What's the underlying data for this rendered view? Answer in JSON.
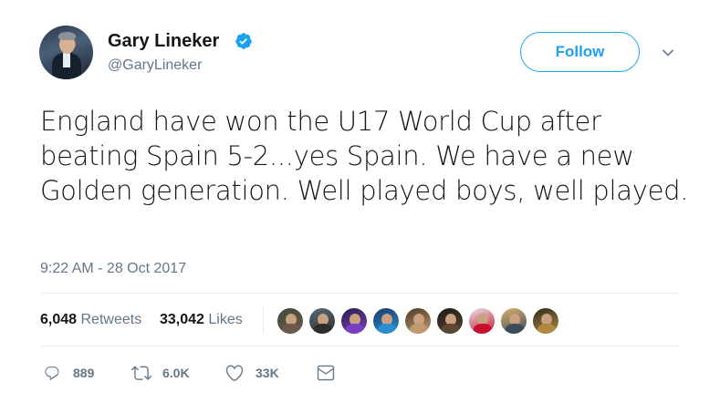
{
  "user": {
    "name": "Gary Lineker",
    "handle": "@GaryLineker",
    "verified": true
  },
  "follow_button": {
    "label": "Follow"
  },
  "tweet": {
    "text": "England have won the U17 World Cup after beating Spain 5-2...yes Spain. We have a new Golden generation. Well played boys, well played.",
    "timestamp": "9:22 AM - 28 Oct 2017"
  },
  "stats": {
    "retweets_count": "6,048",
    "retweets_label": "Retweets",
    "likes_count": "33,042",
    "likes_label": "Likes"
  },
  "likers": [
    {
      "icon": "liker-avatar-1",
      "colors": [
        "#6b5a4a",
        "#3f4a3a"
      ]
    },
    {
      "icon": "liker-avatar-2",
      "colors": [
        "#2c2c2c",
        "#5d6b7a"
      ]
    },
    {
      "icon": "liker-avatar-3",
      "colors": [
        "#7a3fbf",
        "#2a1f4a"
      ]
    },
    {
      "icon": "liker-avatar-4",
      "colors": [
        "#2a8fd0",
        "#1b3b6a"
      ]
    },
    {
      "icon": "liker-avatar-5",
      "colors": [
        "#c09a6e",
        "#4a3a2a"
      ]
    },
    {
      "icon": "liker-avatar-6",
      "colors": [
        "#5b4630",
        "#1e1a16"
      ]
    },
    {
      "icon": "liker-avatar-7",
      "colors": [
        "#c8102e",
        "#e5e5e5"
      ]
    },
    {
      "icon": "liker-avatar-8",
      "colors": [
        "#3c4a5c",
        "#d8b36a"
      ]
    },
    {
      "icon": "liker-avatar-9",
      "colors": [
        "#b08a3e",
        "#2e2a1e"
      ]
    }
  ],
  "actions": {
    "reply_count": "889",
    "retweet_count": "6.0K",
    "like_count": "33K"
  },
  "colors": {
    "accent": "#1da1f2",
    "text": "#14171a",
    "secondary": "#657786",
    "divider": "#e6ecf0"
  }
}
